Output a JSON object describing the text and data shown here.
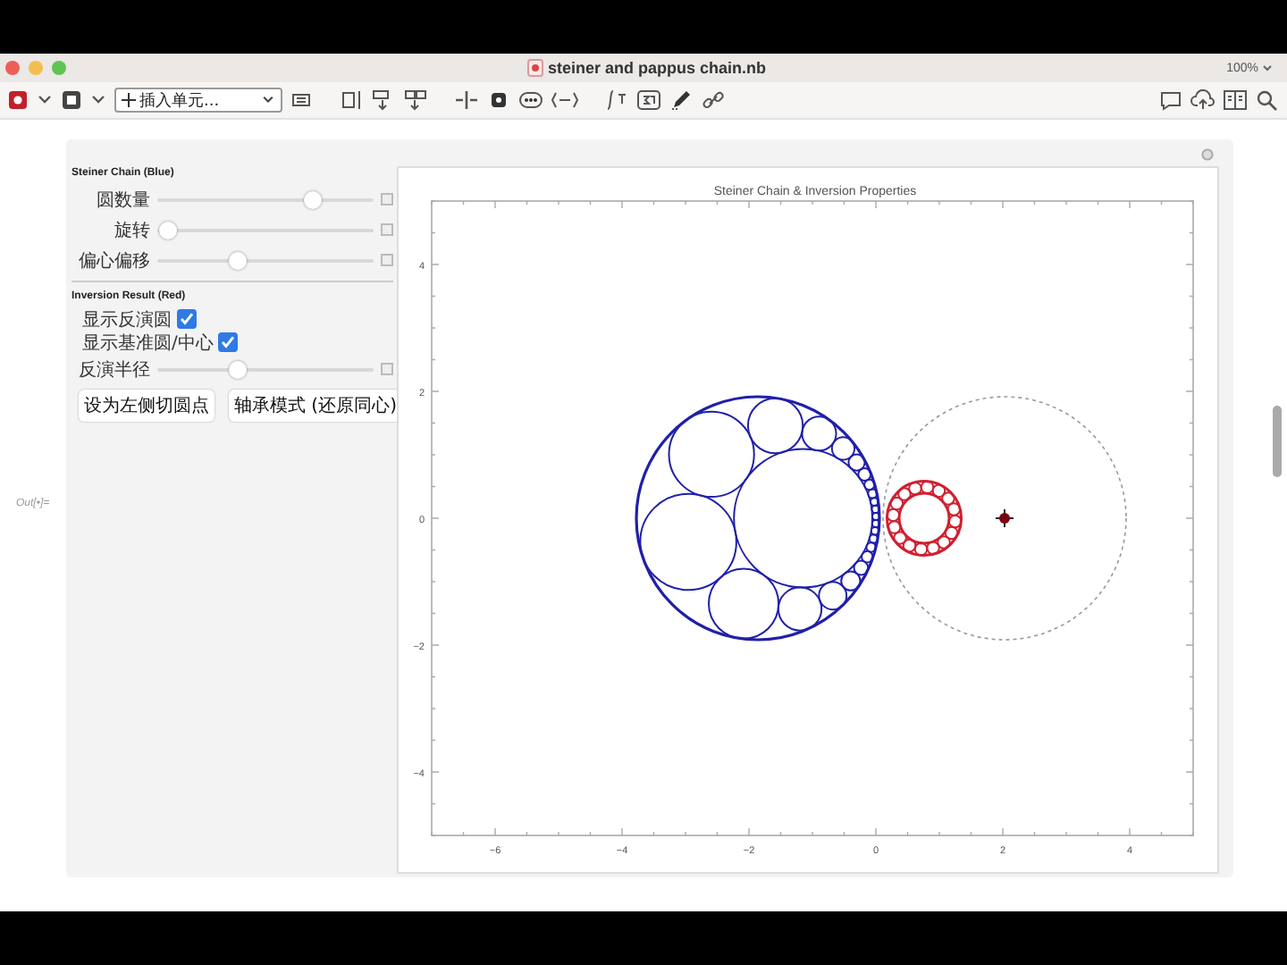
{
  "window": {
    "title": "steiner and pappus chain.nb",
    "zoom": "100%"
  },
  "toolbar": {
    "insert_cell": "插入单元..."
  },
  "output_label": "Out[•]=",
  "panel": {
    "groups": [
      {
        "heading": "Steiner Chain (Blue)",
        "controls": [
          {
            "kind": "slider",
            "label": "圆数量",
            "level": 0.72
          },
          {
            "kind": "slider",
            "label": "旋转",
            "level": 0.05
          },
          {
            "kind": "slider",
            "label": "偏心偏移",
            "level": 0.37
          }
        ]
      },
      {
        "heading": "Inversion Result (Red)",
        "controls": [
          {
            "kind": "checkbox",
            "label": "显示反演圆",
            "checked": true
          },
          {
            "kind": "checkbox",
            "label": "显示基准圆/中心",
            "checked": true
          },
          {
            "kind": "slider",
            "label": "反演半径",
            "level": 0.37
          }
        ]
      }
    ],
    "buttons": [
      "设为左侧切圆点",
      "轴承模式 (还原同心)"
    ]
  },
  "plot": {
    "title": "Steiner Chain & Inversion Properties",
    "xtick_labels": [
      "−6",
      "−4",
      "−2",
      "0",
      "2",
      "4"
    ],
    "ytick_labels": [
      "4",
      "2",
      "0",
      "−2",
      "−4"
    ]
  }
}
